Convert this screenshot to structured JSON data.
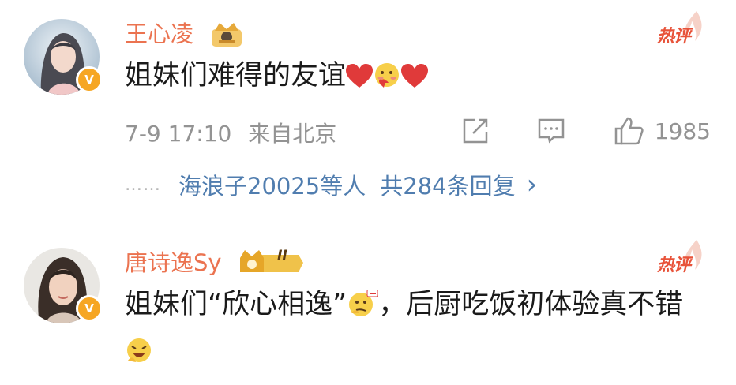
{
  "comments": [
    {
      "username": "王心凌",
      "hot_label": "热评",
      "content_text": "姐妹们难得的友谊",
      "time": "7-9 17:10",
      "source": "来自北京",
      "likes": "1985",
      "replies": {
        "names": "海浪子20025等人",
        "count": "共284条回复",
        "dots": "……",
        "chevron": "›"
      },
      "icons": [
        "share-icon",
        "comment-icon",
        "like-icon",
        "verified-icon",
        "crown-badge-icon"
      ]
    },
    {
      "username": "唐诗逸Sy",
      "hot_label": "热评",
      "badge_text": "II",
      "content_part1": "姐妹们“欣心相逸”",
      "content_part2": "，后厨吃饭初体验真不错",
      "icons": [
        "verified-icon",
        "crown-level-badge-icon"
      ]
    }
  ],
  "colors": {
    "username": "#eb7350",
    "link": "#507daf",
    "meta": "#939393",
    "hot": "#e8533a",
    "heart": "#e03a3a",
    "verified": "#f6a623"
  }
}
